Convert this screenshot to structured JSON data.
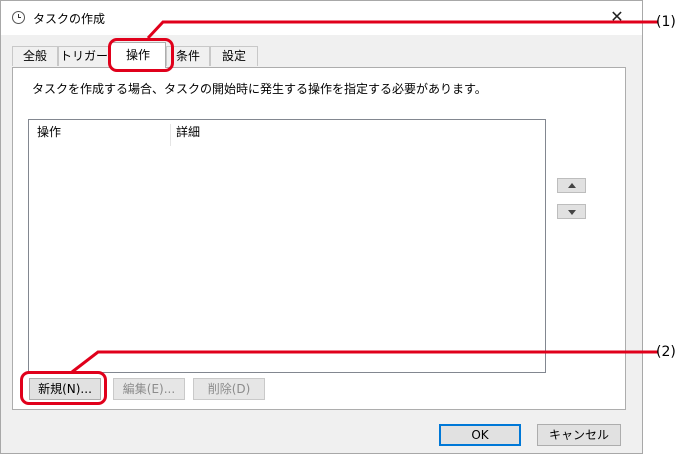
{
  "window": {
    "title": "タスクの作成",
    "close_glyph": "✕"
  },
  "tabs": [
    {
      "label": "全般",
      "active": false
    },
    {
      "label": "トリガー",
      "active": false
    },
    {
      "label": "操作",
      "active": true
    },
    {
      "label": "条件",
      "active": false
    },
    {
      "label": "設定",
      "active": false
    }
  ],
  "panel": {
    "description": "タスクを作成する場合、タスクの開始時に発生する操作を指定する必要があります。",
    "list": {
      "columns": [
        "操作",
        "詳細"
      ],
      "rows": []
    },
    "move_up_icon": "arrow-up-icon",
    "move_down_icon": "arrow-down-icon",
    "buttons": {
      "new": "新規(N)...",
      "edit": "編集(E)...",
      "delete": "削除(D)"
    }
  },
  "footer": {
    "ok": "OK",
    "cancel": "キャンセル"
  },
  "annotations": [
    {
      "label": "(1)"
    },
    {
      "label": "(2)"
    }
  ],
  "colors": {
    "annotation": "#e0001b",
    "focus": "#0078d7"
  }
}
